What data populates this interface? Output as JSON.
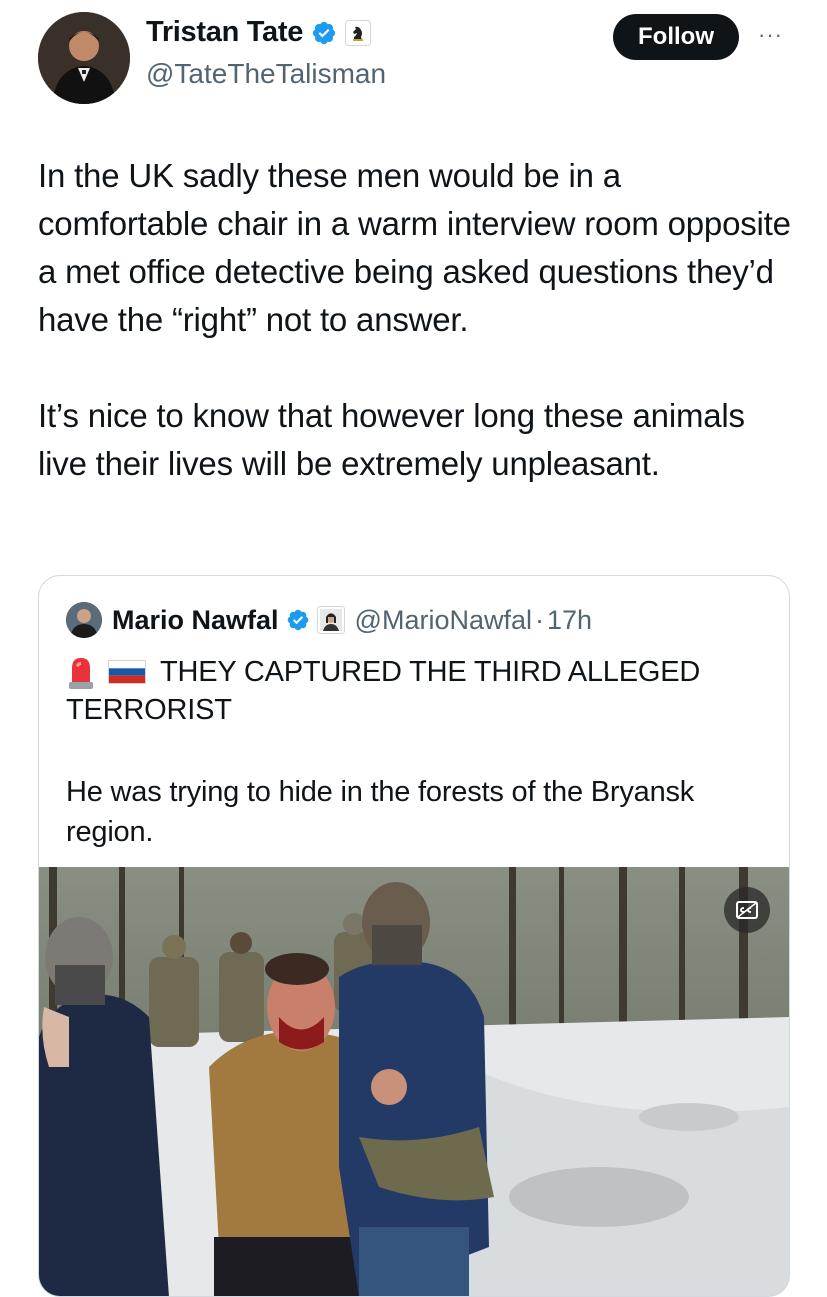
{
  "author": {
    "name": "Tristan Tate",
    "handle": "@TateTheTalisman",
    "avatar_icon": "profile-photo",
    "badge_icon": "verified-badge-icon",
    "affiliation_icon": "chess-knight-icon"
  },
  "follow_label": "Follow",
  "more_label": "···",
  "tweet_text": "In the UK sadly these men would be in a comfortable chair in a warm interview room opposite a met office detective being asked questions they’d have the “right” not to answer.\n\nIt’s nice to know that however long these animals live their lives will be extremely unpleasant.",
  "quote": {
    "name": "Mario Nawfal",
    "handle": "@MarioNawfal",
    "separator": "·",
    "time": "17h",
    "line1": "THEY CAPTURED THE THIRD ALLEGED",
    "line2": "TERRORIST",
    "body": "He was trying to hide in the forests of the Bryansk region.",
    "emoji_icons": [
      "police-light-icon",
      "russia-flag-icon"
    ],
    "media_icon": "captions-icon"
  },
  "colors": {
    "text": "#0f1419",
    "secondary": "#536471",
    "verified_blue": "#1d9bf0",
    "border": "#cfd9de",
    "follow_bg": "#0f1419"
  }
}
